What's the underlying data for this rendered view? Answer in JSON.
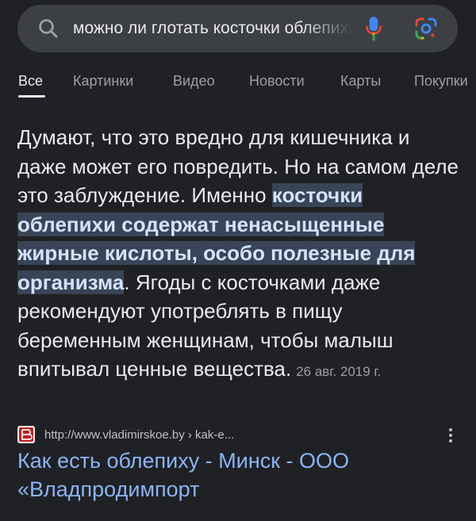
{
  "search": {
    "query": "можно ли глотать косточки облепихи",
    "icons": {
      "left": "search-icon",
      "voice": "microphone-icon",
      "lens": "google-lens-icon"
    }
  },
  "tabs": [
    {
      "label": "Все",
      "active": true
    },
    {
      "label": "Картинки",
      "active": false
    },
    {
      "label": "Видео",
      "active": false
    },
    {
      "label": "Новости",
      "active": false
    },
    {
      "label": "Карты",
      "active": false
    },
    {
      "label": "Покупки",
      "active": false
    }
  ],
  "snippet": {
    "text_before": "Думают, что это вредно для кишечника и даже может его повредить. Но на самом деле это заблуждение. Именно ",
    "highlight": "косточки облепихи содержат ненасыщенные жирные кислоты, особо полезные для организма",
    "text_after": ". Ягоды с косточками даже рекомендуют употреблять в пищу беременным женщинам, чтобы малыш впитывал ценные вещества.",
    "date": "26 авг. 2019 г."
  },
  "result": {
    "url": "http://www.vladimirskoe.by › kak-e...",
    "title": "Как есть облепиху - Минск - ООО «Владпродимпорт",
    "favicon_color": "#c5221f",
    "more_icon": "more-vert-icon"
  },
  "colors": {
    "background": "#202124",
    "search_bar": "#3c4043",
    "link": "#8ab4f8",
    "highlight_bg": "#394457"
  }
}
